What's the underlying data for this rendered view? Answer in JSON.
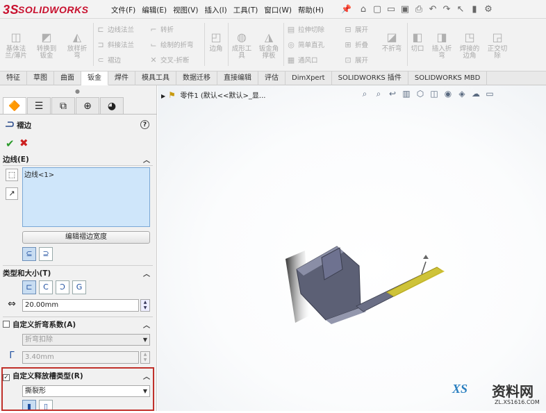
{
  "app": {
    "logo": "SOLIDWORKS",
    "logo_mark": "3S"
  },
  "menu": [
    "文件(F)",
    "编辑(E)",
    "视图(V)",
    "插入(I)",
    "工具(T)",
    "窗口(W)",
    "帮助(H)"
  ],
  "ribbon": {
    "big": [
      "基体法\n兰/薄片",
      "转换到\n钣金",
      "放样折\n弯",
      "成形工\n具",
      "钣金角\n撑板",
      "不折弯",
      "切口",
      "插入折\n弯",
      "焊接的\n边角",
      "正交切\n除"
    ],
    "small": [
      "边线法兰",
      "斜接法兰",
      "褶边",
      "转折",
      "绘制的折弯",
      "交叉-折断",
      "拉伸切除",
      "简单直孔",
      "通风口",
      "展开",
      "折叠",
      "展开"
    ],
    "corner_label": "边角"
  },
  "tabs": [
    "特征",
    "草图",
    "曲面",
    "钣金",
    "焊件",
    "模具工具",
    "数据迁移",
    "直接编辑",
    "评估",
    "DimXpert",
    "SOLIDWORKS 插件",
    "SOLIDWORKS MBD"
  ],
  "active_tab": "钣金",
  "property_manager": {
    "title": "褶边",
    "help": "?",
    "edges_section": "边线(E)",
    "edge_item": "边线<1>",
    "edit_width_button": "编辑褶边宽度",
    "type_size_section": "类型和大小(T)",
    "length_value": "20.00mm",
    "custom_bend_section": "自定义折弯系数(A)",
    "bend_method": "折弯扣除",
    "bend_value": "3.40mm",
    "custom_relief_section": "自定义释放槽类型(R)",
    "relief_type": "撕裂形"
  },
  "graphics": {
    "tree_label": "零件1 (默认<<默认>_显..."
  },
  "watermark": {
    "text": "资料网",
    "url": "ZL.XS1616.COM",
    "logo": "XS"
  },
  "colors": {
    "accent": "#c8102e",
    "highlight": "#c0302a",
    "selection": "#cfe6fa",
    "part": "#5c6075",
    "edge_highlight": "#f0e020"
  }
}
